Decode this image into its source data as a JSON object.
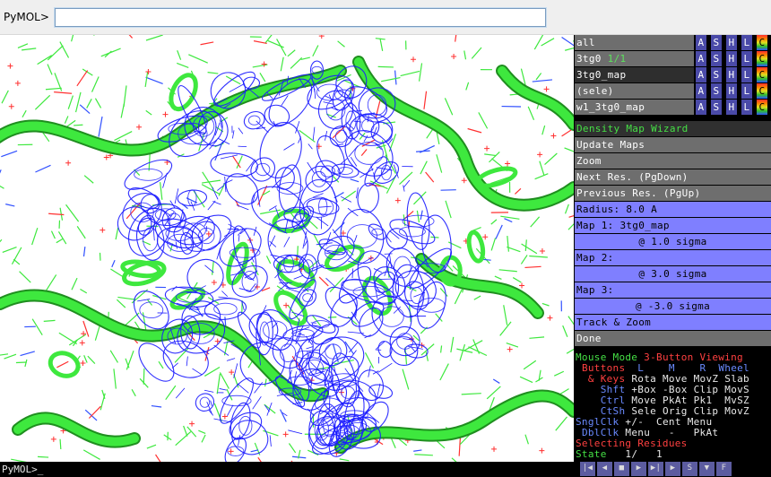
{
  "command": {
    "prompt": "PyMOL>",
    "value": ""
  },
  "console": {
    "line": "PyMOL>_"
  },
  "objects": [
    {
      "name": "all",
      "state": ""
    },
    {
      "name": "3tg0",
      "state": "1/1"
    },
    {
      "name": "3tg0_map",
      "state": ""
    },
    {
      "name": "(sele)",
      "state": ""
    },
    {
      "name": "w1_3tg0_map",
      "state": ""
    }
  ],
  "object_buttons": [
    "A",
    "S",
    "H",
    "L",
    "C"
  ],
  "wizard": {
    "title": "Density Map Wizard",
    "update": "Update Maps",
    "zoom": "Zoom",
    "next": "Next Res. (PgDown)",
    "prev": "Previous Res. (PgUp)",
    "radius": "Radius: 8.0 A",
    "map1": "Map 1: 3tg0_map",
    "map1_sigma": "@ 1.0 sigma",
    "map2": "Map 2:",
    "map2_sigma": "@ 3.0 sigma",
    "map3": "Map 3:",
    "map3_sigma": "@ -3.0 sigma",
    "track": "Track & Zoom",
    "done": "Done"
  },
  "mouse": {
    "header_a": "Mouse Mode",
    "header_b": "3-Button Viewing",
    "r1a": "Buttons",
    "r1b": "L",
    "r1c": "M",
    "r1d": "R",
    "r1e": "Wheel",
    "r2a": "& Keys",
    "r2b": "Rota",
    "r2c": "Move",
    "r2d": "MovZ",
    "r2e": "Slab",
    "r3a": "Shft",
    "r3b": "+Box",
    "r3c": "-Box",
    "r3d": "Clip",
    "r3e": "MovS",
    "r4a": "Ctrl",
    "r4b": "Move",
    "r4c": "PkAt",
    "r4d": "Pk1",
    "r4e": "MvSZ",
    "r5a": "CtSh",
    "r5b": "Sele",
    "r5c": "Orig",
    "r5d": "Clip",
    "r5e": "MovZ",
    "r6a": "SnglClk",
    "r6b": "+/-",
    "r6c": "Cent",
    "r6d": "Menu",
    "r7a": "DblClk",
    "r7b": "Menu",
    "r7c": "-",
    "r7d": "PkAt",
    "selecting": "Selecting Residues",
    "state_label": "State",
    "state_val": "1/",
    "state_max": "1"
  },
  "vcr": [
    "|◀",
    "◀",
    "■",
    "▶",
    "▶|",
    "▶",
    "S",
    "▼",
    "F"
  ],
  "colors": {
    "cartoon": "#3ee83e",
    "mesh": "#1a1aff",
    "oxygen": "#ff3030",
    "nitrogen": "#3050ff",
    "wizard_highlight": "#7f7fff"
  }
}
